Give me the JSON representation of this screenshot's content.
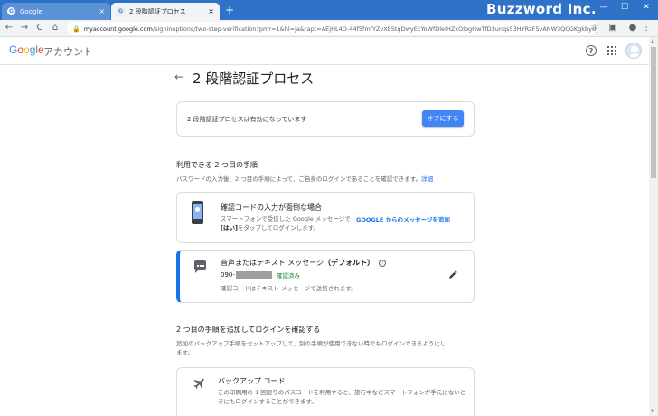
{
  "browser": {
    "tabs": [
      {
        "label": "Google",
        "close": "×"
      },
      {
        "label": "2 段階認証プロセス",
        "close": "×"
      }
    ],
    "new_tab": "+",
    "brand_overlay": "Buzzword Inc.",
    "window_controls": {
      "minimize": "—",
      "maximize": "☐",
      "close": "✕"
    },
    "nav": {
      "back": "←",
      "forward": "→",
      "reload": "C",
      "home": "⌂"
    },
    "url_host": "myaccount.google.com",
    "url_rest": "/signinoptions/two-step-verification?pmr=1&hl=ja&rapt=AEjHL4O-44f5fmfYZvXEStqDwyEcYoWfDleIHZxOlogHwTfD3unqs53HYRzF5vANW3QCGKgkbyd_L..."
  },
  "header": {
    "logo_letters": [
      "G",
      "o",
      "o",
      "g",
      "l",
      "e"
    ],
    "account_label": "アカウント",
    "help_glyph": "?"
  },
  "page": {
    "back_arrow": "←",
    "title": "2 段階認証プロセス",
    "status_text": "2 段階認証プロセスは有効になっています",
    "turn_off_label": "オフにする",
    "available_heading": "利用できる 2 つ目の手順",
    "available_desc": "パスワードの入力後、2 つ目の手順によって、ご自身のログインであることを確認できます。",
    "available_link": "詳細",
    "prompt_card": {
      "title": "確認コードの入力が面倒な場合",
      "desc_pre": "スマートフォンで受信した Google メッセージで",
      "desc_bold": "[はい]",
      "desc_post": "をタップしてログインします。",
      "link": "GOOGLE からのメッセージを追加"
    },
    "voice_card": {
      "title": "音声またはテキスト メッセージ",
      "title_bold": "（デフォルト）",
      "q_glyph": "?",
      "phone_prefix": "090-",
      "verified": "確認済み",
      "desc": "確認コードはテキスト メッセージで送信されます。"
    },
    "add_heading": "2 つ目の手順を追加してログインを確認する",
    "add_desc_1": "追加のバックアップ手順をセットアップして、別の手順が使用できない時でもログインできるようにし",
    "add_desc_2": "ます。",
    "backup_card": {
      "title": "バックアップ コード",
      "desc": "この印刷用の 1 回限りのパスコードを利用すると、旅行中などスマートフォンが手元にないときにもログインすることができます。"
    }
  },
  "colors": {
    "tabstrip": "#2f73c8",
    "accent": "#1a73e8",
    "button": "#4285f4",
    "verified": "#188038"
  }
}
